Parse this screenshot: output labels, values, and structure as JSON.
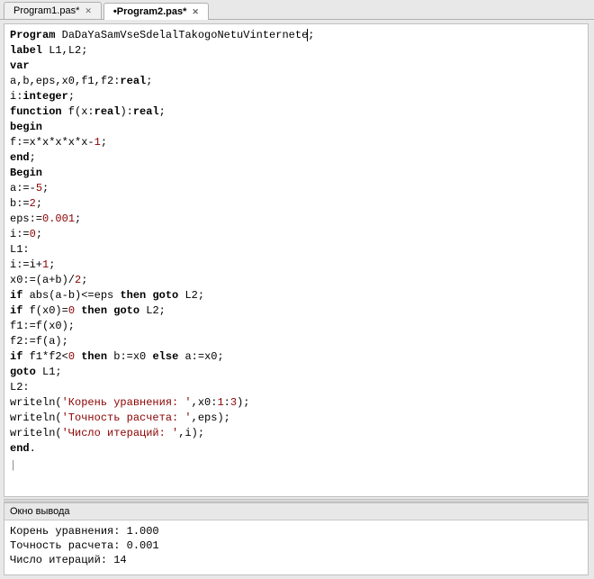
{
  "tabs": [
    {
      "title": "Program1.pas*",
      "active": false
    },
    {
      "title": "•Program2.pas*",
      "active": true
    }
  ],
  "code": {
    "lines": [
      [
        [
          "kw",
          "Program"
        ],
        [
          "",
          " DaDaYaSamVseSdelalTakogoNetuVinternete"
        ],
        [
          "caret",
          ""
        ],
        [
          "",
          ";"
        ]
      ],
      [
        [
          "kw",
          "label"
        ],
        [
          "",
          " L1,L2;"
        ]
      ],
      [
        [
          "kw",
          "var"
        ]
      ],
      [
        [
          "",
          "a,b,eps,x0,f1,f2:"
        ],
        [
          "type",
          "real"
        ],
        [
          "",
          ";"
        ]
      ],
      [
        [
          "",
          "i:"
        ],
        [
          "type",
          "integer"
        ],
        [
          "",
          ";"
        ]
      ],
      [
        [
          "kw",
          "function"
        ],
        [
          "",
          " f(x:"
        ],
        [
          "type",
          "real"
        ],
        [
          "",
          "):"
        ],
        [
          "type",
          "real"
        ],
        [
          "",
          ";"
        ]
      ],
      [
        [
          "kw",
          "begin"
        ]
      ],
      [
        [
          "",
          "f:=x*x*x*x*x-"
        ],
        [
          "num",
          "1"
        ],
        [
          "",
          ";"
        ]
      ],
      [
        [
          "kw",
          "end"
        ],
        [
          "",
          ";"
        ]
      ],
      [
        [
          "kw",
          "Begin"
        ]
      ],
      [
        [
          "",
          "a:=-"
        ],
        [
          "num",
          "5"
        ],
        [
          "",
          ";"
        ]
      ],
      [
        [
          "",
          "b:="
        ],
        [
          "num",
          "2"
        ],
        [
          "",
          ";"
        ]
      ],
      [
        [
          "",
          "eps:="
        ],
        [
          "num",
          "0.001"
        ],
        [
          "",
          ";"
        ]
      ],
      [
        [
          "",
          "i:="
        ],
        [
          "num",
          "0"
        ],
        [
          "",
          ";"
        ]
      ],
      [
        [
          "",
          "L1:"
        ]
      ],
      [
        [
          "",
          "i:=i+"
        ],
        [
          "num",
          "1"
        ],
        [
          "",
          ";"
        ]
      ],
      [
        [
          "",
          "x0:=(a+b)/"
        ],
        [
          "num",
          "2"
        ],
        [
          "",
          ";"
        ]
      ],
      [
        [
          "kw",
          "if"
        ],
        [
          "",
          " abs(a-b)<=eps "
        ],
        [
          "kw",
          "then"
        ],
        [
          "",
          " "
        ],
        [
          "kw",
          "goto"
        ],
        [
          "",
          " L2;"
        ]
      ],
      [
        [
          "kw",
          "if"
        ],
        [
          "",
          " f(x0)="
        ],
        [
          "num",
          "0"
        ],
        [
          "",
          " "
        ],
        [
          "kw",
          "then"
        ],
        [
          "",
          " "
        ],
        [
          "kw",
          "goto"
        ],
        [
          "",
          " L2;"
        ]
      ],
      [
        [
          "",
          "f1:=f(x0);"
        ]
      ],
      [
        [
          "",
          "f2:=f(a);"
        ]
      ],
      [
        [
          "kw",
          "if"
        ],
        [
          "",
          " f1*f2<"
        ],
        [
          "num",
          "0"
        ],
        [
          "",
          " "
        ],
        [
          "kw",
          "then"
        ],
        [
          "",
          " b:=x0 "
        ],
        [
          "kw",
          "else"
        ],
        [
          "",
          " a:=x0;"
        ]
      ],
      [
        [
          "kw",
          "goto"
        ],
        [
          "",
          " L1;"
        ]
      ],
      [
        [
          "",
          "L2:"
        ]
      ],
      [
        [
          "",
          "writeln("
        ],
        [
          "str",
          "'Корень уравнения: '"
        ],
        [
          "",
          ",x0:"
        ],
        [
          "num",
          "1"
        ],
        [
          "",
          ":"
        ],
        [
          "num",
          "3"
        ],
        [
          "",
          ");"
        ]
      ],
      [
        [
          "",
          "writeln("
        ],
        [
          "str",
          "'Точность расчета: '"
        ],
        [
          "",
          ",eps);"
        ]
      ],
      [
        [
          "",
          "writeln("
        ],
        [
          "str",
          "'Число итераций: '"
        ],
        [
          "",
          ",i);"
        ]
      ],
      [
        [
          "kw",
          "end"
        ],
        [
          "",
          "."
        ]
      ]
    ],
    "caret_tail": "|"
  },
  "output": {
    "title": "Окно вывода",
    "lines": [
      "Корень уравнения: 1.000",
      "Точность расчета: 0.001",
      "Число итераций: 14"
    ]
  }
}
